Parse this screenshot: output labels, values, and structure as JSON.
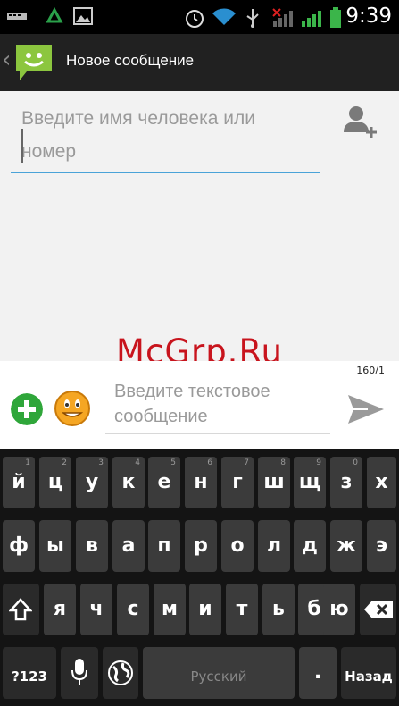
{
  "status_bar": {
    "time": "9:39",
    "icons": [
      "keyboard-icon",
      "recycle-icon",
      "image-icon",
      "alarm-icon",
      "wifi-icon",
      "usb-icon",
      "no-signal-icon",
      "signal-icon",
      "battery-icon"
    ]
  },
  "action_bar": {
    "title": "Новое сообщение",
    "logo": "messaging-app-icon"
  },
  "recipient": {
    "placeholder_line1": "Введите имя человека или",
    "placeholder_line2": "номер"
  },
  "watermark": "McGrp.Ru",
  "compose": {
    "counter": "160/1",
    "placeholder_line1": "Введите текстовое",
    "placeholder_line2": "сообщение"
  },
  "keyboard": {
    "row1": [
      {
        "label": "й",
        "hint": "1"
      },
      {
        "label": "ц",
        "hint": "2"
      },
      {
        "label": "у",
        "hint": "3"
      },
      {
        "label": "к",
        "hint": "4"
      },
      {
        "label": "е",
        "hint": "5"
      },
      {
        "label": "н",
        "hint": "6"
      },
      {
        "label": "г",
        "hint": "7"
      },
      {
        "label": "ш",
        "hint": "8"
      },
      {
        "label": "щ",
        "hint": "9"
      },
      {
        "label": "з",
        "hint": "0"
      },
      {
        "label": "х",
        "hint": ""
      }
    ],
    "row2": [
      "ф",
      "ы",
      "в",
      "а",
      "п",
      "р",
      "о",
      "л",
      "д",
      "ж",
      "э"
    ],
    "row3": [
      "я",
      "ч",
      "с",
      "м",
      "и",
      "т",
      "ь",
      "б",
      "ю"
    ],
    "symbols_label": "?123",
    "space_label": "Русский",
    "period_label": ".",
    "enter_label": "Назад"
  },
  "colors": {
    "action_bar": "#212121",
    "accent": "#4aa3d8",
    "watermark": "#c8141d",
    "attach": "#2fa63a",
    "key": "#3b3b3b"
  }
}
